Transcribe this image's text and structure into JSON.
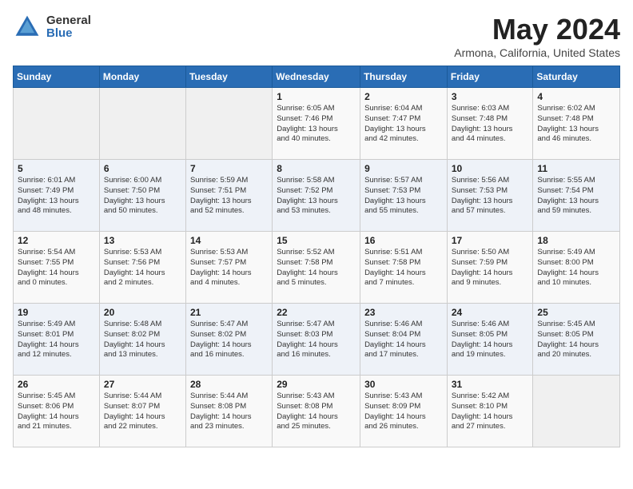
{
  "header": {
    "logo_general": "General",
    "logo_blue": "Blue",
    "title": "May 2024",
    "location": "Armona, California, United States"
  },
  "days_of_week": [
    "Sunday",
    "Monday",
    "Tuesday",
    "Wednesday",
    "Thursday",
    "Friday",
    "Saturday"
  ],
  "weeks": [
    [
      {
        "day": "",
        "info": ""
      },
      {
        "day": "",
        "info": ""
      },
      {
        "day": "",
        "info": ""
      },
      {
        "day": "1",
        "info": "Sunrise: 6:05 AM\nSunset: 7:46 PM\nDaylight: 13 hours\nand 40 minutes."
      },
      {
        "day": "2",
        "info": "Sunrise: 6:04 AM\nSunset: 7:47 PM\nDaylight: 13 hours\nand 42 minutes."
      },
      {
        "day": "3",
        "info": "Sunrise: 6:03 AM\nSunset: 7:48 PM\nDaylight: 13 hours\nand 44 minutes."
      },
      {
        "day": "4",
        "info": "Sunrise: 6:02 AM\nSunset: 7:48 PM\nDaylight: 13 hours\nand 46 minutes."
      }
    ],
    [
      {
        "day": "5",
        "info": "Sunrise: 6:01 AM\nSunset: 7:49 PM\nDaylight: 13 hours\nand 48 minutes."
      },
      {
        "day": "6",
        "info": "Sunrise: 6:00 AM\nSunset: 7:50 PM\nDaylight: 13 hours\nand 50 minutes."
      },
      {
        "day": "7",
        "info": "Sunrise: 5:59 AM\nSunset: 7:51 PM\nDaylight: 13 hours\nand 52 minutes."
      },
      {
        "day": "8",
        "info": "Sunrise: 5:58 AM\nSunset: 7:52 PM\nDaylight: 13 hours\nand 53 minutes."
      },
      {
        "day": "9",
        "info": "Sunrise: 5:57 AM\nSunset: 7:53 PM\nDaylight: 13 hours\nand 55 minutes."
      },
      {
        "day": "10",
        "info": "Sunrise: 5:56 AM\nSunset: 7:53 PM\nDaylight: 13 hours\nand 57 minutes."
      },
      {
        "day": "11",
        "info": "Sunrise: 5:55 AM\nSunset: 7:54 PM\nDaylight: 13 hours\nand 59 minutes."
      }
    ],
    [
      {
        "day": "12",
        "info": "Sunrise: 5:54 AM\nSunset: 7:55 PM\nDaylight: 14 hours\nand 0 minutes."
      },
      {
        "day": "13",
        "info": "Sunrise: 5:53 AM\nSunset: 7:56 PM\nDaylight: 14 hours\nand 2 minutes."
      },
      {
        "day": "14",
        "info": "Sunrise: 5:53 AM\nSunset: 7:57 PM\nDaylight: 14 hours\nand 4 minutes."
      },
      {
        "day": "15",
        "info": "Sunrise: 5:52 AM\nSunset: 7:58 PM\nDaylight: 14 hours\nand 5 minutes."
      },
      {
        "day": "16",
        "info": "Sunrise: 5:51 AM\nSunset: 7:58 PM\nDaylight: 14 hours\nand 7 minutes."
      },
      {
        "day": "17",
        "info": "Sunrise: 5:50 AM\nSunset: 7:59 PM\nDaylight: 14 hours\nand 9 minutes."
      },
      {
        "day": "18",
        "info": "Sunrise: 5:49 AM\nSunset: 8:00 PM\nDaylight: 14 hours\nand 10 minutes."
      }
    ],
    [
      {
        "day": "19",
        "info": "Sunrise: 5:49 AM\nSunset: 8:01 PM\nDaylight: 14 hours\nand 12 minutes."
      },
      {
        "day": "20",
        "info": "Sunrise: 5:48 AM\nSunset: 8:02 PM\nDaylight: 14 hours\nand 13 minutes."
      },
      {
        "day": "21",
        "info": "Sunrise: 5:47 AM\nSunset: 8:02 PM\nDaylight: 14 hours\nand 16 minutes."
      },
      {
        "day": "22",
        "info": "Sunrise: 5:47 AM\nSunset: 8:03 PM\nDaylight: 14 hours\nand 16 minutes."
      },
      {
        "day": "23",
        "info": "Sunrise: 5:46 AM\nSunset: 8:04 PM\nDaylight: 14 hours\nand 17 minutes."
      },
      {
        "day": "24",
        "info": "Sunrise: 5:46 AM\nSunset: 8:05 PM\nDaylight: 14 hours\nand 19 minutes."
      },
      {
        "day": "25",
        "info": "Sunrise: 5:45 AM\nSunset: 8:05 PM\nDaylight: 14 hours\nand 20 minutes."
      }
    ],
    [
      {
        "day": "26",
        "info": "Sunrise: 5:45 AM\nSunset: 8:06 PM\nDaylight: 14 hours\nand 21 minutes."
      },
      {
        "day": "27",
        "info": "Sunrise: 5:44 AM\nSunset: 8:07 PM\nDaylight: 14 hours\nand 22 minutes."
      },
      {
        "day": "28",
        "info": "Sunrise: 5:44 AM\nSunset: 8:08 PM\nDaylight: 14 hours\nand 23 minutes."
      },
      {
        "day": "29",
        "info": "Sunrise: 5:43 AM\nSunset: 8:08 PM\nDaylight: 14 hours\nand 25 minutes."
      },
      {
        "day": "30",
        "info": "Sunrise: 5:43 AM\nSunset: 8:09 PM\nDaylight: 14 hours\nand 26 minutes."
      },
      {
        "day": "31",
        "info": "Sunrise: 5:42 AM\nSunset: 8:10 PM\nDaylight: 14 hours\nand 27 minutes."
      },
      {
        "day": "",
        "info": ""
      }
    ]
  ]
}
